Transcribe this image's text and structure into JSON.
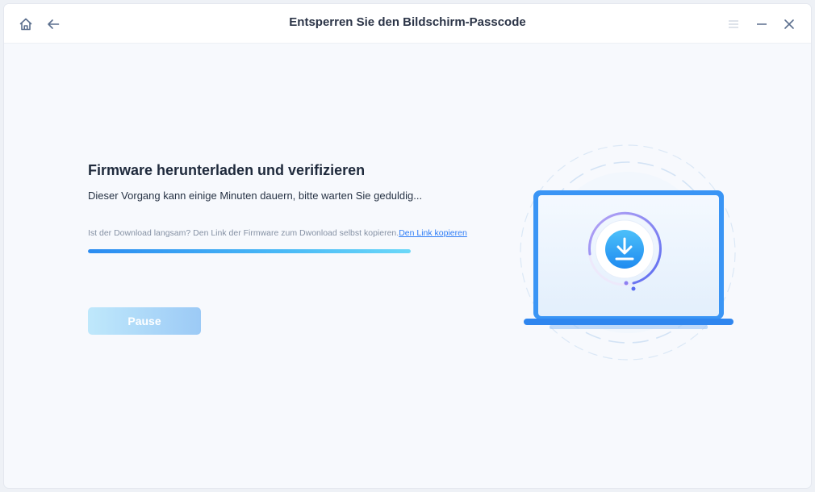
{
  "window": {
    "title": "Entsperren Sie den Bildschirm-Passcode",
    "icons": [
      "home-icon",
      "arrow-left-icon",
      "menu-icon",
      "minimize-icon",
      "close-icon"
    ]
  },
  "main": {
    "heading": "Firmware herunterladen und verifizieren",
    "subtitle": "Dieser Vorgang kann einige Minuten dauern, bitte warten Sie geduldig...",
    "hint_text": "Ist der Download langsam? Den Link der Firmware zum Dwonload selbst kopieren.",
    "hint_link": "Den Link kopieren",
    "progress_percent": 100,
    "pause_label": "Pause"
  },
  "illustration": {
    "icon": "download-icon"
  },
  "colors": {
    "accent": "#2f7df6",
    "progress_start": "#2b8cf1",
    "progress_end": "#6bd8f8",
    "pause_button_start": "#bfe8fb",
    "pause_button_end": "#9ccaf6"
  }
}
